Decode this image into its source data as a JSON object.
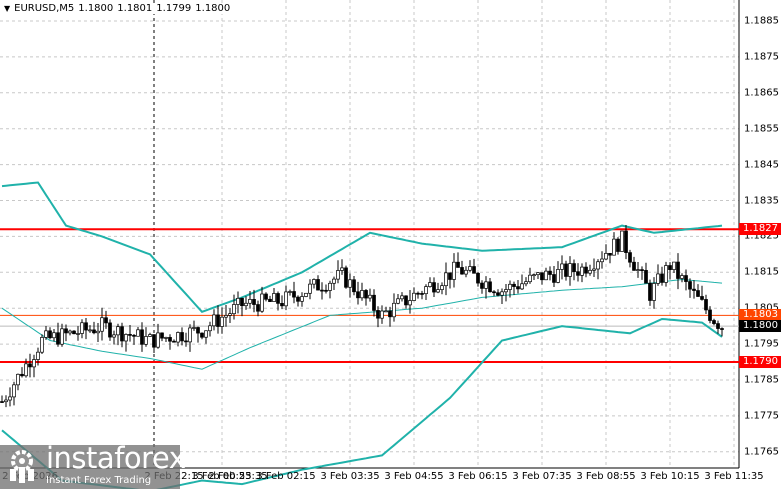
{
  "header": {
    "symbol": "EURUSD,M5",
    "open": "1.1800",
    "high": "1.1801",
    "low": "1.1799",
    "close": "1.1800"
  },
  "price_axis": [
    "1.1885",
    "1.1875",
    "1.1865",
    "1.1855",
    "1.1845",
    "1.1835",
    "1.1825",
    "1.1815",
    "1.1805",
    "1.1795",
    "1.1785",
    "1.1775",
    "1.1765"
  ],
  "time_axis": [
    {
      "label": "2 Feb 2026",
      "bar": 2
    },
    {
      "label": "2 Feb 22:15",
      "bar": 38
    },
    {
      "label": "2 Feb 23:35",
      "bar": 54
    },
    {
      "label": "3 Feb 00:55",
      "bar": 55
    },
    {
      "label": "3 Feb 02:15",
      "bar": 71
    },
    {
      "label": "3 Feb 03:35",
      "bar": 87
    },
    {
      "label": "3 Feb 04:55",
      "bar": 103
    },
    {
      "label": "3 Feb 06:15",
      "bar": 119
    },
    {
      "label": "3 Feb 07:35",
      "bar": 135
    },
    {
      "label": "3 Feb 08:55",
      "bar": 151
    },
    {
      "label": "3 Feb 10:15",
      "bar": 167
    },
    {
      "label": "3 Feb 11:35",
      "bar": 183
    }
  ],
  "levels": [
    {
      "label": "1.1827",
      "price": 1.1827,
      "color": "#ff0000"
    },
    {
      "label": "1.1790",
      "price": 1.179,
      "color": "#ff0000"
    },
    {
      "label": "1.1803",
      "price": 1.1803,
      "color": "#ff4500"
    },
    {
      "label": "1.1800",
      "price": 1.18,
      "color": "#000000"
    }
  ],
  "cursor_bar": 38,
  "colors": {
    "band": "#20b2aa",
    "bull": "#ffffff",
    "bear": "#000000"
  },
  "chart_data": {
    "type": "candlestick",
    "ylim": [
      1.1762,
      1.1891
    ],
    "bars": 185,
    "price_path": [
      [
        0,
        1.1779
      ],
      [
        10,
        1.1796
      ],
      [
        25,
        1.18
      ],
      [
        37,
        1.1796
      ],
      [
        50,
        1.1799
      ],
      [
        60,
        1.1806
      ],
      [
        70,
        1.1807
      ],
      [
        78,
        1.1811
      ],
      [
        85,
        1.1814
      ],
      [
        95,
        1.1803
      ],
      [
        105,
        1.181
      ],
      [
        114,
        1.1816
      ],
      [
        125,
        1.181
      ],
      [
        135,
        1.1814
      ],
      [
        145,
        1.1816
      ],
      [
        155,
        1.1824
      ],
      [
        162,
        1.1809
      ],
      [
        167,
        1.1817
      ],
      [
        172,
        1.181
      ],
      [
        178,
        1.1802
      ],
      [
        180,
        1.18
      ]
    ],
    "bands": {
      "upper": [
        [
          0,
          1.1839
        ],
        [
          9,
          1.184
        ],
        [
          16,
          1.1828
        ],
        [
          25,
          1.1825
        ],
        [
          37,
          1.182
        ],
        [
          50,
          1.1804
        ],
        [
          60,
          1.1808
        ],
        [
          75,
          1.1815
        ],
        [
          92,
          1.1826
        ],
        [
          105,
          1.1823
        ],
        [
          120,
          1.1821
        ],
        [
          140,
          1.1822
        ],
        [
          155,
          1.1828
        ],
        [
          163,
          1.1826
        ],
        [
          180,
          1.1828
        ]
      ],
      "middle": [
        [
          0,
          1.1805
        ],
        [
          12,
          1.1796
        ],
        [
          25,
          1.1793
        ],
        [
          37,
          1.1791
        ],
        [
          50,
          1.1788
        ],
        [
          62,
          1.1794
        ],
        [
          82,
          1.1803
        ],
        [
          105,
          1.1805
        ],
        [
          120,
          1.1808
        ],
        [
          140,
          1.181
        ],
        [
          155,
          1.1811
        ],
        [
          170,
          1.1813
        ],
        [
          180,
          1.1812
        ]
      ],
      "lower": [
        [
          0,
          1.1771
        ],
        [
          15,
          1.1757
        ],
        [
          37,
          1.1754
        ],
        [
          50,
          1.1757
        ],
        [
          60,
          1.1756
        ],
        [
          75,
          1.176
        ],
        [
          95,
          1.1764
        ],
        [
          112,
          1.178
        ],
        [
          125,
          1.1796
        ],
        [
          140,
          1.18
        ],
        [
          157,
          1.1798
        ],
        [
          165,
          1.1802
        ],
        [
          175,
          1.1801
        ],
        [
          180,
          1.1797
        ]
      ]
    }
  },
  "logo": {
    "name": "instaforex",
    "tagline": "Instant Forex Trading"
  }
}
